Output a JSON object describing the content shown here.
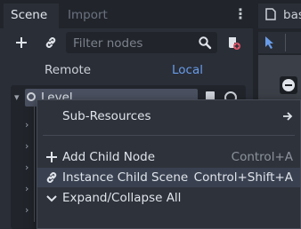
{
  "scene_dock": {
    "tabs": [
      {
        "label": "Scene",
        "active": true
      },
      {
        "label": "Import",
        "active": false
      }
    ],
    "filter": {
      "placeholder": "Filter nodes",
      "value": ""
    },
    "remote_label": "Remote",
    "local_label": "Local",
    "tree": {
      "root_label": "Level"
    }
  },
  "right_panel": {
    "tab_label": "bas"
  },
  "context_menu": {
    "items": [
      {
        "label": "Sub-Resources",
        "shortcut": "",
        "icon": "arrow-right-icon"
      },
      {
        "label": "Add Child Node",
        "shortcut": "Control+A",
        "icon": "plus-icon"
      },
      {
        "label": "Instance Child Scene",
        "shortcut": "Control+Shift+A",
        "icon": "link-icon"
      },
      {
        "label": "Expand/Collapse All",
        "shortcut": "",
        "icon": "chevron-down-icon"
      }
    ]
  },
  "colors": {
    "panel_bg": "#2a2e37",
    "dark_bg": "#21252b",
    "accent": "#699ce8",
    "menu_bg": "#2e323a",
    "menu_hover": "#394150",
    "text": "#dfe3ea",
    "muted": "#8d939d"
  }
}
